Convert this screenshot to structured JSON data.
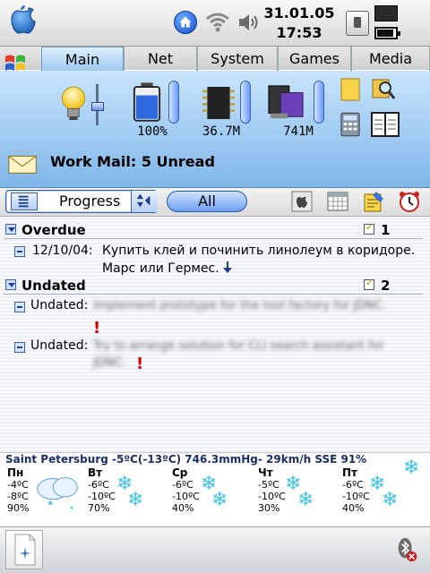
{
  "status_bar": {
    "date": "31.01.05",
    "time": "17:53"
  },
  "tabs": [
    {
      "label": "Main",
      "active": true
    },
    {
      "label": "Net",
      "active": false
    },
    {
      "label": "System",
      "active": false
    },
    {
      "label": "Games",
      "active": false
    },
    {
      "label": "Media",
      "active": false
    }
  ],
  "stats": {
    "battery_label": "100%",
    "memory_label": "36.7M",
    "storage_label": "741M"
  },
  "mail": {
    "title": "Work Mail: 5 Unread"
  },
  "toolbar": {
    "filter_value": "Progress",
    "all_label": "All"
  },
  "tasks": {
    "overdue": {
      "title": "Overdue",
      "count": "1",
      "items": [
        {
          "date": "12/10/04:",
          "text_line1": "Купить клей и починить линолеум в коридоре.",
          "text_line2": "Марс или Гермес."
        }
      ]
    },
    "undated": {
      "title": "Undated",
      "count": "2",
      "items": [
        {
          "label": "Undated:",
          "text_line1": "Implement prototype for the tool factory for JDNC.",
          "text_line2": ""
        },
        {
          "label": "Undated:",
          "text_line1": "Try to arrange solution for CLI search assistant for",
          "text_line2": "JDNC."
        }
      ]
    }
  },
  "weather": {
    "header": "Saint Petersburg -5ºC(-13ºC) 746.3mmHg- 29km/h SSE 91%",
    "days": [
      {
        "name": "Пн",
        "high": "-4ºC",
        "low": "-8ºC",
        "humidity": "90%"
      },
      {
        "name": "Вт",
        "high": "-6ºC",
        "low": "-10ºC",
        "humidity": "70%"
      },
      {
        "name": "Ср",
        "high": "-6ºC",
        "low": "-10ºC",
        "humidity": "40%"
      },
      {
        "name": "Чт",
        "high": "-5ºC",
        "low": "-10ºC",
        "humidity": "30%"
      },
      {
        "name": "Пт",
        "high": "-6ºC",
        "low": "-10ºC",
        "humidity": "40%"
      }
    ]
  },
  "colors": {
    "panel_top": "#c9e4fb",
    "panel_bottom": "#7fb7ea",
    "accent_blue": "#2c54a7",
    "alert_red": "#d40000",
    "snow_blue": "#3ec4e8"
  },
  "icons": {
    "top": [
      "apple-logo-icon",
      "home-icon",
      "wifi-icon",
      "speaker-icon",
      "switch-icon",
      "chip-icon",
      "battery-icon"
    ],
    "panel": [
      "lightbulb-icon",
      "battery-level-icon",
      "memory-chip-icon",
      "storage-card-icon",
      "notes-icon",
      "search-icon",
      "calculator-icon",
      "dictionary-icon"
    ],
    "tools": [
      "finder-icon",
      "calendar-icon",
      "notes-edit-icon",
      "alarm-clock-icon"
    ],
    "bottom": [
      "document-icon",
      "bluetooth-icon"
    ]
  }
}
